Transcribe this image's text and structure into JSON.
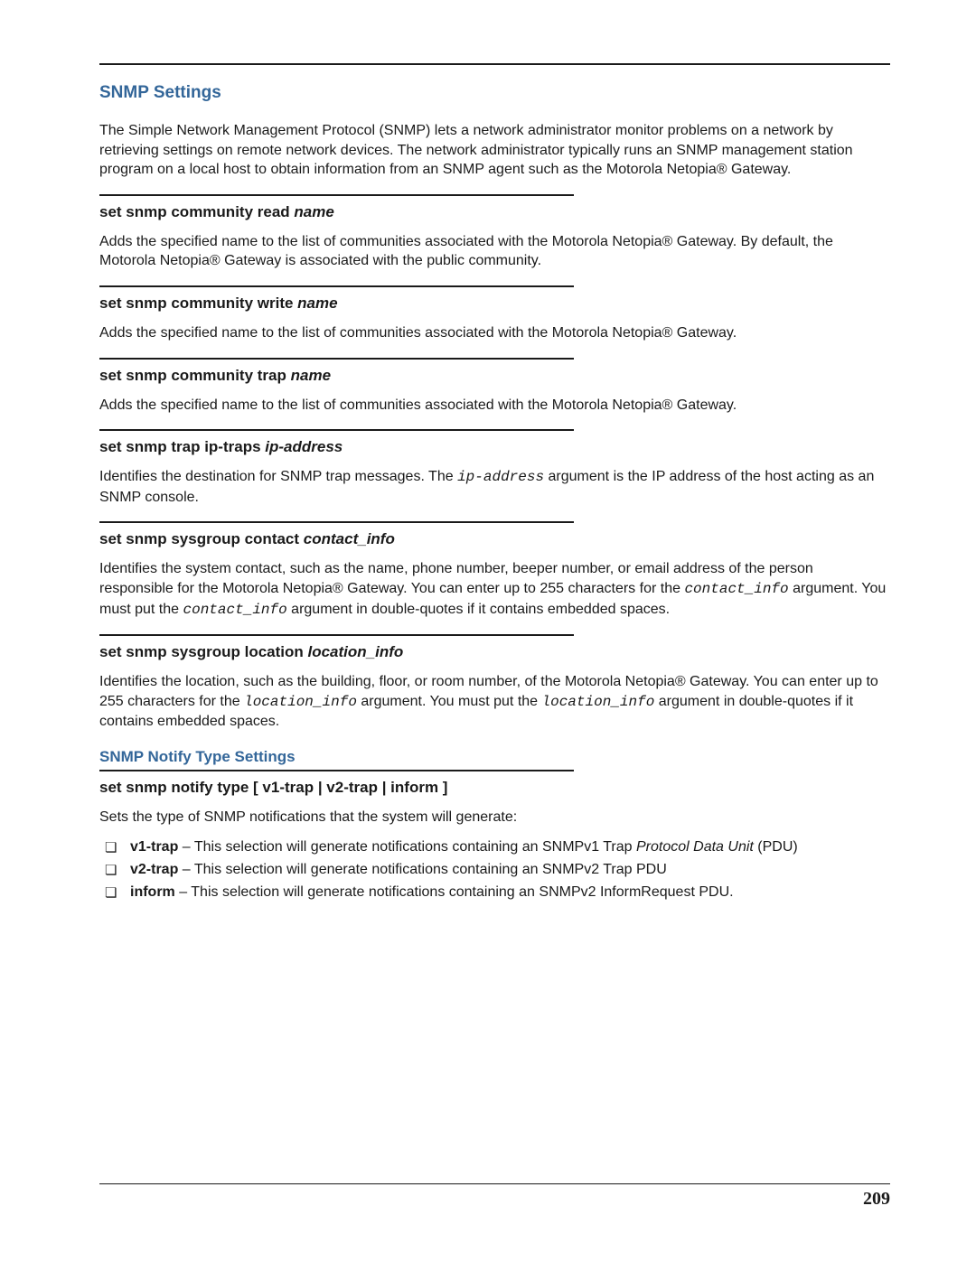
{
  "title": "SNMP Settings",
  "intro": "The Simple Network Management Protocol (SNMP) lets a network administrator monitor problems on a network by retrieving settings on remote network devices. The network administrator typically runs an SNMP management station program on a local host to obtain information from an SNMP agent such as the Motorola Netopia® Gateway.",
  "sections": [
    {
      "cmd_prefix": "set snmp community read ",
      "cmd_arg": "name",
      "body_plain": "Adds the specified name to the list of communities associated with the Motorola Netopia® Gateway. By default, the Motorola Netopia® Gateway is associated with the public community."
    },
    {
      "cmd_prefix": "set snmp community write ",
      "cmd_arg": "name",
      "body_plain": "Adds the specified name to the list of communities associated with the Motorola Netopia® Gateway."
    },
    {
      "cmd_prefix": "set snmp community trap ",
      "cmd_arg": "name",
      "body_plain": "Adds the specified name to the list of communities associated with the Motorola Netopia® Gateway."
    },
    {
      "cmd_prefix": "set snmp trap ip-traps ",
      "cmd_arg": "ip-address",
      "body_runs": [
        {
          "t": "Identifies the destination for SNMP trap messages. The "
        },
        {
          "t": "ip-address",
          "code": true
        },
        {
          "t": " argument is the IP address of the host acting as an SNMP console."
        }
      ]
    },
    {
      "cmd_prefix": "set snmp sysgroup contact ",
      "cmd_arg": "contact_info",
      "body_runs": [
        {
          "t": "Identifies the system contact, such as the name, phone number, beeper number, or email address of the person responsible for the Motorola Netopia® Gateway. You can enter up to 255 characters for the "
        },
        {
          "t": "contact_info",
          "code": true
        },
        {
          "t": " argument. You must put the "
        },
        {
          "t": "contact_info",
          "code": true
        },
        {
          "t": " argument in double-quotes if it contains embedded spaces."
        }
      ]
    },
    {
      "cmd_prefix": "set snmp sysgroup location ",
      "cmd_arg": "location_info",
      "body_runs": [
        {
          "t": "Identifies the location, such as the building, floor, or room number, of the Motorola Netopia® Gateway. You can enter up to 255 characters for the "
        },
        {
          "t": "location_info",
          "code": true
        },
        {
          "t": " argument. You must put the "
        },
        {
          "t": "location_info",
          "code": true
        },
        {
          "t": " argument in double-quotes if it contains embedded spaces."
        }
      ]
    }
  ],
  "notify": {
    "title": "SNMP Notify Type Settings",
    "cmd": "set snmp notify type [ v1-trap | v2-trap | inform ]",
    "lead": "Sets the type of SNMP notifications that the system will generate:",
    "items": [
      {
        "runs": [
          {
            "t": "v1-trap",
            "bold": true
          },
          {
            "t": " – This selection will generate notifications containing an SNMPv1 Trap "
          },
          {
            "t": "Protocol Data Unit",
            "italic": true
          },
          {
            "t": " (PDU)"
          }
        ]
      },
      {
        "runs": [
          {
            "t": "v2-trap",
            "bold": true
          },
          {
            "t": " – This selection will generate notifications containing an SNMPv2 Trap PDU"
          }
        ]
      },
      {
        "runs": [
          {
            "t": "inform",
            "bold": true
          },
          {
            "t": " – This selection will generate notifications containing an SNMPv2 InformRequest PDU."
          }
        ]
      }
    ]
  },
  "page_number": "209",
  "bullet_marker": "❏"
}
